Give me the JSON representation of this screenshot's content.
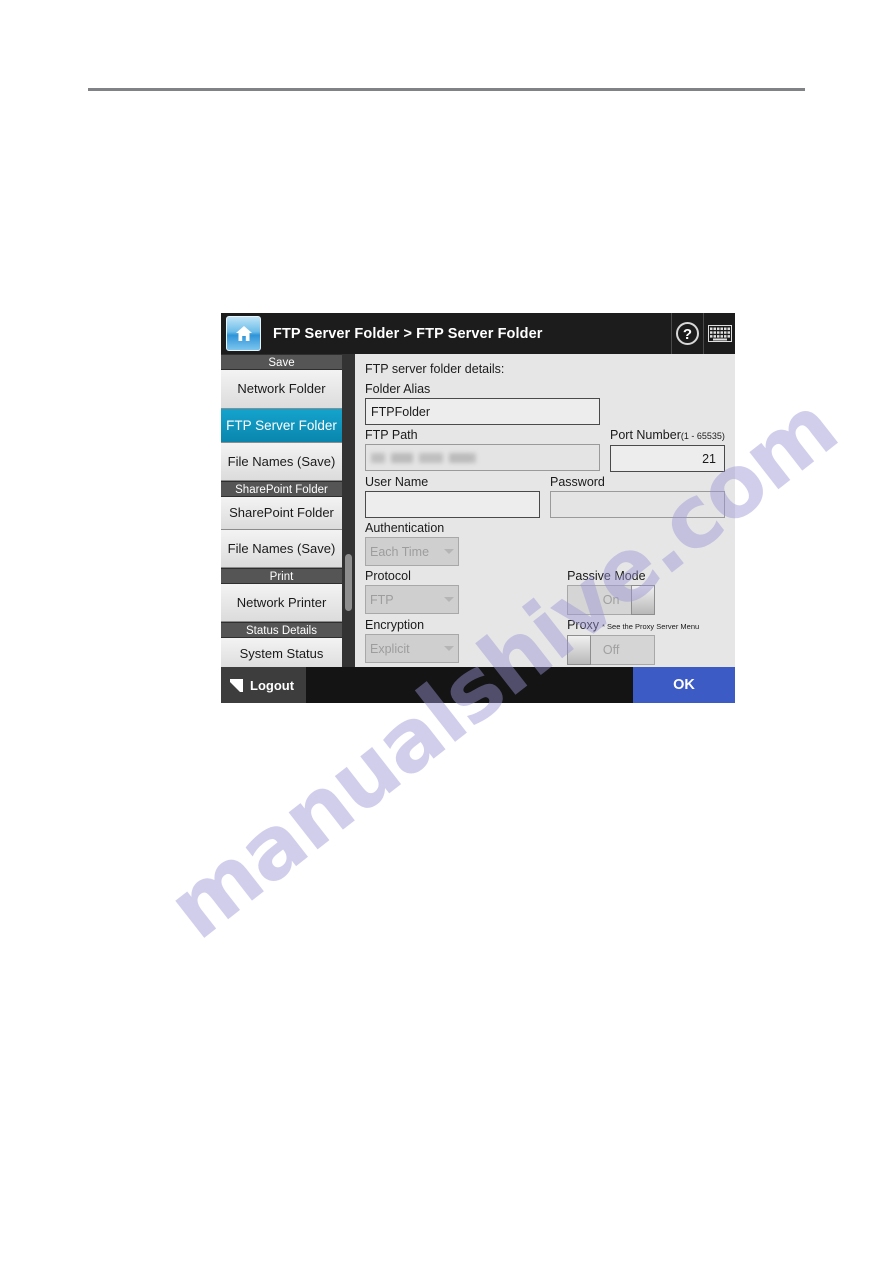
{
  "header": {
    "breadcrumb": "FTP Server Folder > FTP Server Folder",
    "home_icon": "home-icon",
    "help_icon": "?",
    "keyboard_icon": "keyboard-icon"
  },
  "sidebar": {
    "groups": [
      {
        "header": "Save",
        "items": [
          {
            "label": "Network Folder",
            "selected": false
          },
          {
            "label": "FTP Server Folder",
            "selected": true
          },
          {
            "label": "File Names (Save)",
            "selected": false
          }
        ]
      },
      {
        "header": "SharePoint Folder",
        "items": [
          {
            "label": "SharePoint Folder",
            "selected": false
          },
          {
            "label": "File Names (Save)",
            "selected": false
          }
        ]
      },
      {
        "header": "Print",
        "items": [
          {
            "label": "Network Printer",
            "selected": false
          }
        ]
      },
      {
        "header": "Status Details",
        "items": [
          {
            "label": "System Status",
            "selected": false
          }
        ]
      }
    ]
  },
  "content": {
    "title": "FTP server folder details:",
    "folder_alias": {
      "label": "Folder Alias",
      "value": "FTPFolder"
    },
    "ftp_path": {
      "label": "FTP Path",
      "value": ""
    },
    "port_number": {
      "label": "Port Number",
      "hint": "(1 - 65535)",
      "value": "21"
    },
    "user_name": {
      "label": "User Name",
      "value": ""
    },
    "password": {
      "label": "Password",
      "value": ""
    },
    "authentication": {
      "label": "Authentication",
      "value": "Each Time"
    },
    "protocol": {
      "label": "Protocol",
      "value": "FTP"
    },
    "encryption": {
      "label": "Encryption",
      "value": "Explicit"
    },
    "passive_mode": {
      "label": "Passive Mode",
      "value": "On",
      "state": "on"
    },
    "proxy": {
      "label": "Proxy",
      "note": "* See the Proxy Server Menu",
      "value": "Off",
      "state": "off"
    }
  },
  "footer": {
    "logout_label": "Logout",
    "ok_label": "OK"
  },
  "watermark": {
    "line1": "manualshive.com"
  },
  "colors": {
    "accent_selected": "#0a86ad",
    "ok_button": "#3c5bc4",
    "header_bar": "#1c1c1c",
    "panel_bg": "#e6e6e6"
  }
}
